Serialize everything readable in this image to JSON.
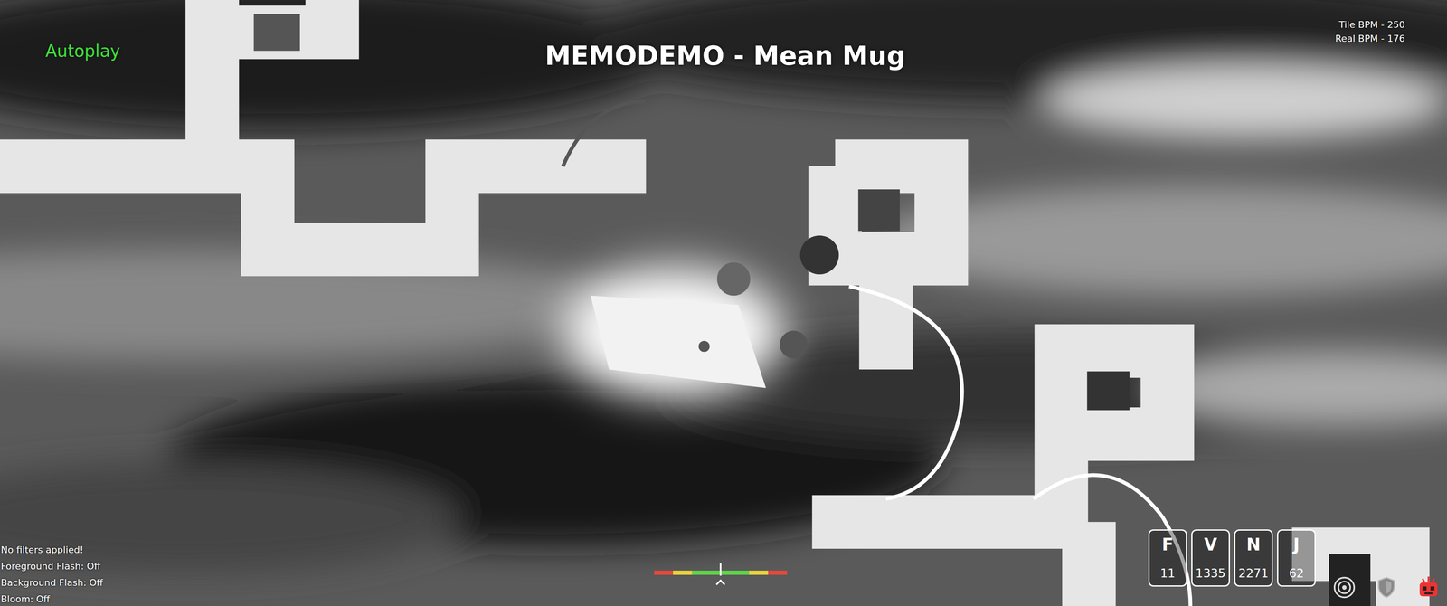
{
  "song": {
    "title": "MEMODEMO - Mean Mug"
  },
  "mode": {
    "label": "Autoplay",
    "on": true
  },
  "bpm": [
    "Tile BPM - 250",
    "Real BPM - 176"
  ],
  "settings": [
    "No filters applied!",
    "Foreground Flash: Off",
    "Background Flash: Off",
    "Bloom: Off"
  ],
  "judgements": [
    {
      "label": "F",
      "count": "11"
    },
    {
      "label": "V",
      "count": "1335"
    },
    {
      "label": "N",
      "count": "2271"
    },
    {
      "label": "J",
      "count": "62"
    }
  ],
  "timing_bar": {
    "level": 0.5
  }
}
